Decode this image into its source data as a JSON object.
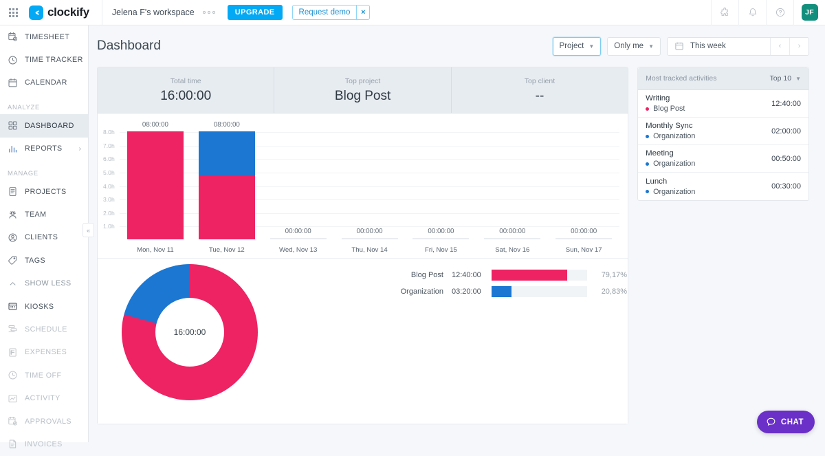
{
  "topbar": {
    "apps_icon": "apps-grid-icon",
    "brand": "clockify",
    "workspace": "Jelena F's workspace",
    "workspace_menu_icon": "workspace-dots-icon",
    "upgrade_label": "UPGRADE",
    "demo_label": "Request demo",
    "demo_close": "×",
    "icons": [
      {
        "name": "integrations-icon",
        "glyph": "puzzle"
      },
      {
        "name": "notifications-bell-icon",
        "glyph": "bell"
      },
      {
        "name": "help-icon",
        "glyph": "question"
      }
    ],
    "avatar_initials": "JF"
  },
  "sidebar": {
    "items": [
      {
        "label": "TIMESHEET",
        "icon": "timesheet-icon",
        "state": "normal"
      },
      {
        "label": "TIME TRACKER",
        "icon": "clock-icon",
        "state": "normal"
      },
      {
        "label": "CALENDAR",
        "icon": "calendar-icon",
        "state": "normal"
      }
    ],
    "section_analyze": "ANALYZE",
    "analyze_items": [
      {
        "label": "DASHBOARD",
        "icon": "dashboard-grid-icon",
        "state": "active"
      },
      {
        "label": "REPORTS",
        "icon": "bar-report-icon",
        "state": "normal",
        "chevron": "›"
      }
    ],
    "section_manage": "MANAGE",
    "manage_items": [
      {
        "label": "PROJECTS",
        "icon": "projects-icon",
        "state": "normal"
      },
      {
        "label": "TEAM",
        "icon": "team-icon",
        "state": "normal"
      },
      {
        "label": "CLIENTS",
        "icon": "clients-icon",
        "state": "normal"
      },
      {
        "label": "TAGS",
        "icon": "tag-icon",
        "state": "normal"
      }
    ],
    "show_less": {
      "label": "SHOW LESS",
      "icon": "chevron-up-icon"
    },
    "extra_items": [
      {
        "label": "KIOSKS",
        "icon": "kiosk-icon",
        "state": "normal"
      },
      {
        "label": "SCHEDULE",
        "icon": "schedule-icon",
        "state": "dim"
      },
      {
        "label": "EXPENSES",
        "icon": "expenses-icon",
        "state": "dim"
      },
      {
        "label": "TIME OFF",
        "icon": "timeoff-icon",
        "state": "dim"
      },
      {
        "label": "ACTIVITY",
        "icon": "activity-icon",
        "state": "dim"
      },
      {
        "label": "APPROVALS",
        "icon": "approvals-icon",
        "state": "dim"
      },
      {
        "label": "INVOICES",
        "icon": "invoices-icon",
        "state": "dim"
      }
    ],
    "collapse_icon": "collapse-sidebar-icon"
  },
  "page": {
    "title": "Dashboard",
    "filters": {
      "project": "Project",
      "user": "Only me",
      "date_range": "This week",
      "calendar_icon": "calendar-icon",
      "prev_icon": "‹",
      "next_icon": "›"
    }
  },
  "summary": [
    {
      "label": "Total time",
      "value": "16:00:00"
    },
    {
      "label": "Top project",
      "value": "Blog Post"
    },
    {
      "label": "Top client",
      "value": "--"
    }
  ],
  "activities": {
    "header": "Most tracked activities",
    "top_selector": "Top 10",
    "rows": [
      {
        "title": "Writing",
        "project": "Blog Post",
        "color": "#ed2363",
        "time": "12:40:00"
      },
      {
        "title": "Monthly Sync",
        "project": "Organization",
        "color": "#1b77d2",
        "time": "02:00:00"
      },
      {
        "title": "Meeting",
        "project": "Organization",
        "color": "#1b77d2",
        "time": "00:50:00"
      },
      {
        "title": "Lunch",
        "project": "Organization",
        "color": "#1b77d2",
        "time": "00:30:00"
      }
    ]
  },
  "chat": {
    "label": "CHAT",
    "icon": "chat-bubble-icon"
  },
  "colors": {
    "pink": "#ed2363",
    "blue": "#1b77d2",
    "accent": "#03a9f4",
    "chat_purple": "#6b30c8",
    "avatar_teal": "#138f7d"
  },
  "chart_data": [
    {
      "type": "bar",
      "title": "",
      "stacked": true,
      "categories": [
        "Mon, Nov 11",
        "Tue, Nov 12",
        "Wed, Nov 13",
        "Thu, Nov 14",
        "Fri, Nov 15",
        "Sat, Nov 16",
        "Sun, Nov 17"
      ],
      "bar_labels": [
        "08:00:00",
        "08:00:00",
        "00:00:00",
        "00:00:00",
        "00:00:00",
        "00:00:00",
        "00:00:00"
      ],
      "series": [
        {
          "name": "Blog Post",
          "color": "#ed2363",
          "values": [
            8.0,
            4.667,
            0,
            0,
            0,
            0,
            0
          ]
        },
        {
          "name": "Organization",
          "color": "#1b77d2",
          "values": [
            0,
            3.333,
            0,
            0,
            0,
            0,
            0
          ]
        }
      ],
      "ylabel": "",
      "xlabel": "",
      "ylim": [
        0,
        8
      ],
      "yticks": [
        "1.0h",
        "2.0h",
        "3.0h",
        "4.0h",
        "5.0h",
        "6.0h",
        "7.0h",
        "8.0h"
      ],
      "ytick_values": [
        1,
        2,
        3,
        4,
        5,
        6,
        7,
        8
      ],
      "grid": true,
      "legend": "none"
    },
    {
      "type": "pie",
      "variant": "donut",
      "center_label": "16:00:00",
      "title": "",
      "labels": [
        "Blog Post",
        "Organization"
      ],
      "values": [
        79.17,
        20.83
      ],
      "times": [
        "12:40:00",
        "03:20:00"
      ],
      "percent_labels": [
        "79,17%",
        "20,83%"
      ],
      "colors": [
        "#ed2363",
        "#1b77d2"
      ],
      "legend": "right"
    }
  ]
}
